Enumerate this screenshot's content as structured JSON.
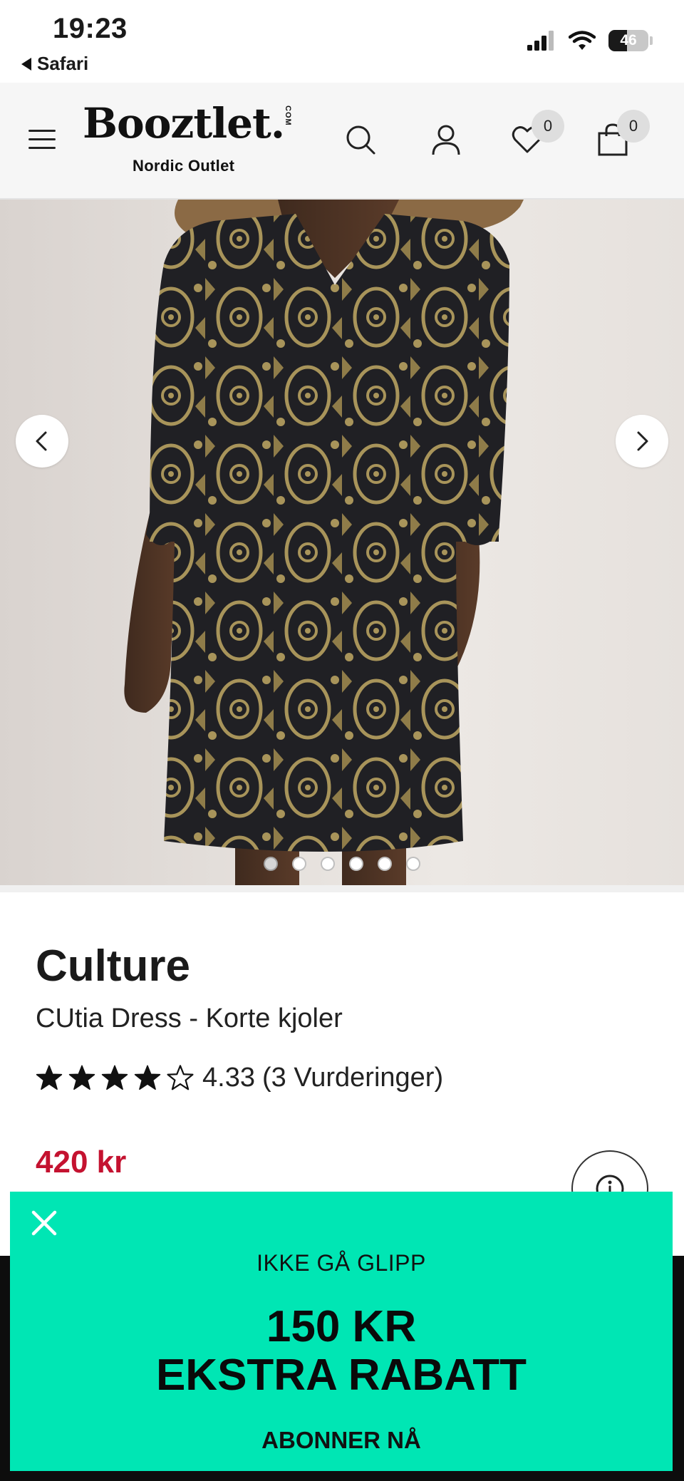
{
  "status_bar": {
    "time": "19:23",
    "back_app": "Safari",
    "battery_level": "46",
    "battery_fraction": 0.46
  },
  "header": {
    "logo_text": "Booztlet.",
    "logo_com": "COM",
    "logo_subtitle": "Nordic Outlet",
    "wishlist_count": "0",
    "cart_count": "0",
    "icons": {
      "menu": "hamburger-menu-icon",
      "search": "search-icon",
      "account": "user-icon",
      "wishlist": "heart-icon",
      "cart": "shopping-bag-icon"
    }
  },
  "gallery": {
    "image_count": 6,
    "active_index": 0,
    "prev_icon": "chevron-left-icon",
    "next_icon": "chevron-right-icon"
  },
  "product": {
    "brand": "Culture",
    "name": "CUtia Dress - Korte kjoler",
    "rating_value": "4.33",
    "rating_count_text": "(3 Vurderinger)",
    "rating_stars": 4.33,
    "price": "420 kr",
    "price_color": "#c41230",
    "info_icon": "info-icon"
  },
  "promo": {
    "kicker": "IKKE GÅ GLIPP",
    "headline_line1": "150 KR",
    "headline_line2": "EKSTRA RABATT",
    "cta": "ABONNER NÅ",
    "background_color": "#00e6b4",
    "close_icon": "close-icon"
  }
}
